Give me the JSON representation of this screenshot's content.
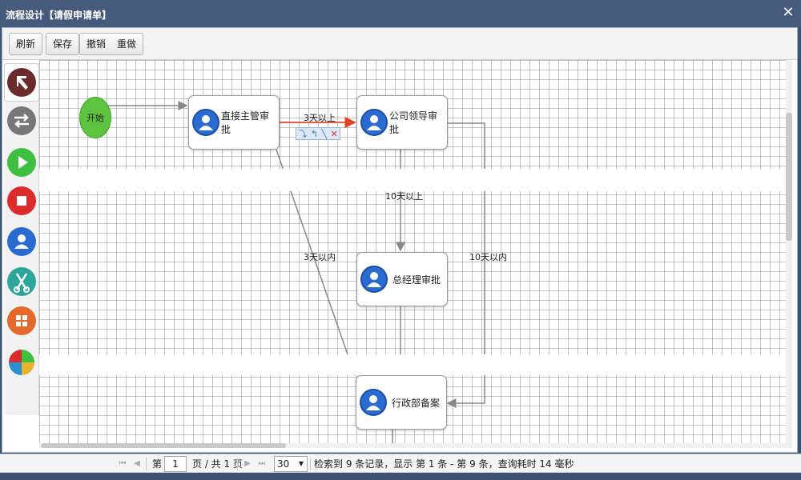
{
  "window": {
    "title": "流程设计【请假申请单】",
    "close_glyph": "✕"
  },
  "toolbar": {
    "refresh": "刷新",
    "save": "保存",
    "undo": "撤销",
    "redo": "重做"
  },
  "palette": [
    {
      "name": "select-tool",
      "icon": "arrow-pointer-icon",
      "color": "#6b2b2b"
    },
    {
      "name": "connect-tool",
      "icon": "swap-arrows-icon",
      "color": "#777777"
    },
    {
      "name": "start-tool",
      "icon": "play-icon",
      "color": "#3fbf3f"
    },
    {
      "name": "end-tool",
      "icon": "stop-icon",
      "color": "#dd2b2b"
    },
    {
      "name": "task-tool",
      "icon": "user-icon",
      "color": "#2a6bd1"
    },
    {
      "name": "fork-tool",
      "icon": "fork-icon",
      "color": "#2ea59b"
    },
    {
      "name": "subprocess-tool",
      "icon": "grid-icon",
      "color": "#e36a2a"
    },
    {
      "name": "chart-tool",
      "icon": "pie-icon",
      "color": "#e8b52a"
    }
  ],
  "flow": {
    "start_label": "开始",
    "nodes": {
      "supervisor": "直接主管审批",
      "leader": "公司领导审批",
      "gm": "总经理审批",
      "admin": "行政部备案"
    },
    "edges": {
      "over3": "3天以上",
      "within3": "3天以内",
      "over10": "10天以上",
      "within10": "10天以内"
    },
    "edge_tools": [
      "⤵",
      "↰",
      "╲",
      "✕"
    ],
    "selected_edge_color": "#e0452a",
    "edge_color": "#888888"
  },
  "pager": {
    "page_label": "第",
    "page_value": "1",
    "page_total": "页 / 共 1 页",
    "page_size": "30",
    "summary": "检索到 9 条记录，显示 第 1 条 - 第 9 条，查询耗时 14 毫秒"
  }
}
